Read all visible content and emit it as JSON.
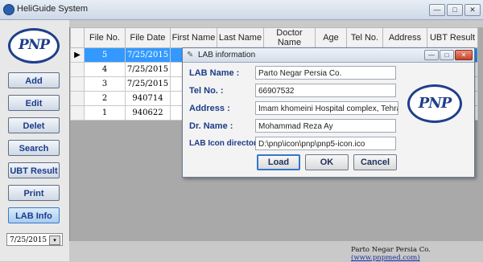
{
  "window": {
    "title": "HeliGuide System"
  },
  "logo": {
    "text": "PNP"
  },
  "sidebar": {
    "buttons": [
      {
        "label": "Add"
      },
      {
        "label": "Edit"
      },
      {
        "label": "Delet"
      },
      {
        "label": "Search"
      },
      {
        "label": "UBT Result"
      },
      {
        "label": "Print"
      },
      {
        "label": "LAB Info"
      }
    ],
    "date_value": "7/25/2015"
  },
  "grid": {
    "columns": [
      "File No.",
      "File Date",
      "First Name",
      "Last Name",
      "Doctor Name",
      "Age",
      "Tel No.",
      "Address",
      "UBT Result"
    ],
    "rows": [
      {
        "file_no": "5",
        "file_date": "7/25/2015"
      },
      {
        "file_no": "4",
        "file_date": "7/25/2015"
      },
      {
        "file_no": "3",
        "file_date": "7/25/2015"
      },
      {
        "file_no": "2",
        "file_date": "940714"
      },
      {
        "file_no": "1",
        "file_date": "940622"
      }
    ],
    "current_row_marker": "▶"
  },
  "dialog": {
    "title": "LAB information",
    "fields": {
      "lab_name": {
        "label": "LAB Name :",
        "value": "Parto Negar Persia Co."
      },
      "tel_no": {
        "label": "Tel No. :",
        "value": "66907532"
      },
      "address": {
        "label": "Address :",
        "value": "Imam khomeini Hospital complex, Tehran"
      },
      "dr_name": {
        "label": "Dr. Name :",
        "value": "Mohammad Reza Ay"
      },
      "icon_dir": {
        "label": "LAB Icon directory:",
        "value": "D:\\pnp\\icon\\pnp\\pnp5-icon.ico"
      }
    },
    "buttons": {
      "load": "Load",
      "ok": "OK",
      "cancel": "Cancel"
    },
    "logo_text": "PNP"
  },
  "footer": {
    "company": "Parto Negar Persia Co.",
    "url": "(www.pnpmed.com)"
  }
}
